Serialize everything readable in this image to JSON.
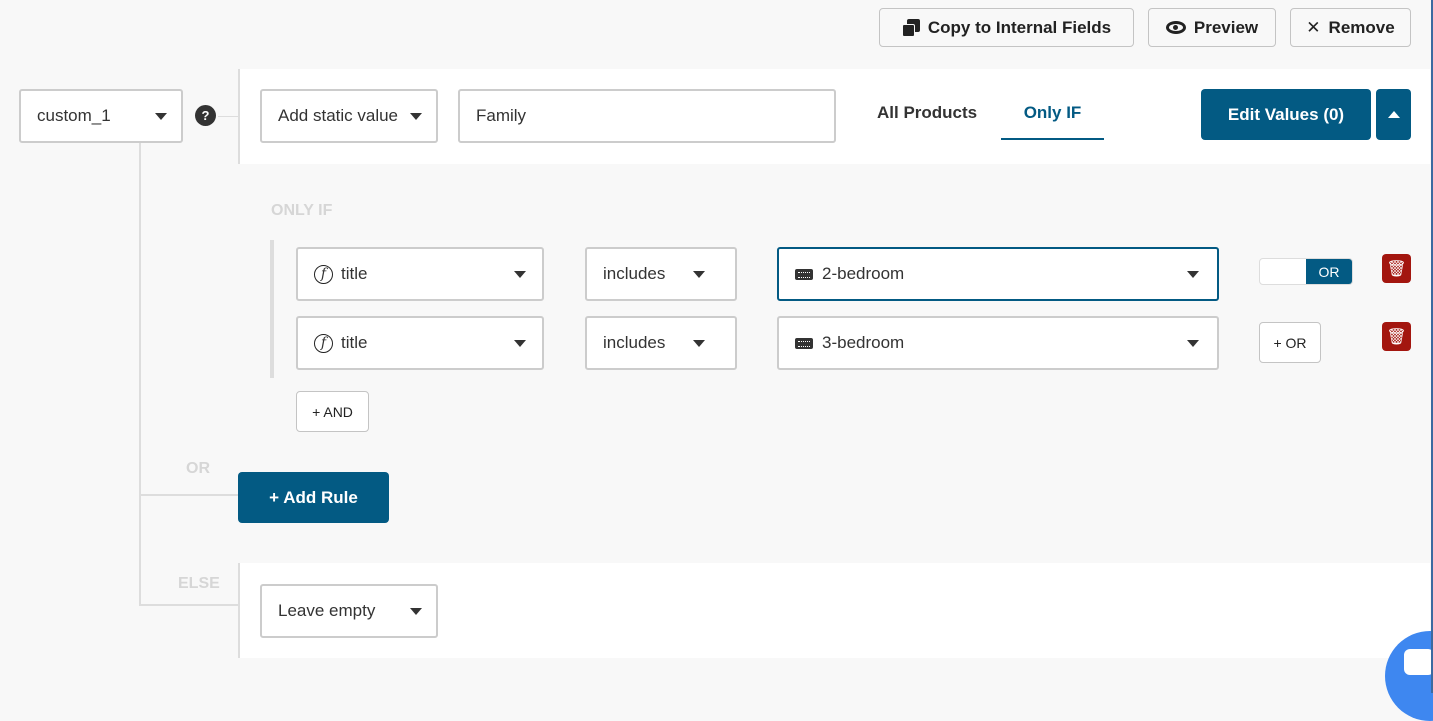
{
  "toolbar": {
    "copy_label": "Copy to Internal Fields",
    "preview_label": "Preview",
    "remove_label": "Remove"
  },
  "field": {
    "name": "custom_1",
    "help": "?"
  },
  "value": {
    "type": "Add static value",
    "text": "Family"
  },
  "tabs": [
    {
      "label": "All Products",
      "active": false
    },
    {
      "label": "Only IF",
      "active": true
    }
  ],
  "edit_values_label": "Edit Values (0)",
  "only_if_label": "ONLY IF",
  "conditions": [
    {
      "field": "title",
      "operator": "includes",
      "value": "2-bedroom",
      "connector": "OR",
      "connector_state": "toggle"
    },
    {
      "field": "title",
      "operator": "includes",
      "value": "3-bedroom",
      "connector": "+ OR",
      "connector_state": "button"
    }
  ],
  "and_label": "+ AND",
  "or_label": "OR",
  "add_rule_label": "+ Add Rule",
  "else_label": "ELSE",
  "else_value": "Leave empty",
  "colors": {
    "accent": "#035a83",
    "danger": "#a3160f",
    "chat": "#3e87f0"
  }
}
